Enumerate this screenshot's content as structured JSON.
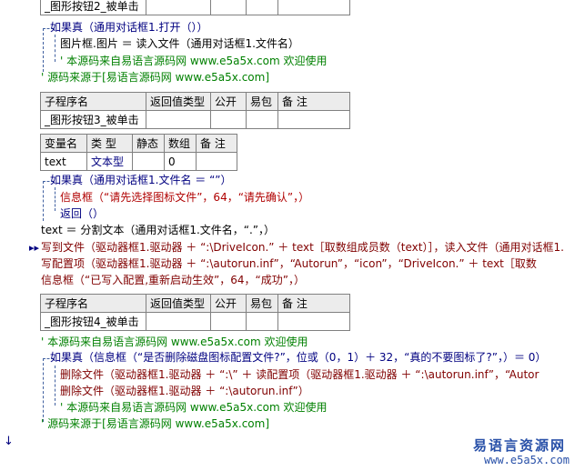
{
  "sub1": {
    "name": "_图形按钮2_被单击"
  },
  "block1": {
    "if_line": "如果真（通用对话框1.打开（））",
    "assign_line": "图片框.图片 ＝ 读入文件（通用对话框1.文件名）",
    "comment1": "' 本源码来自易语言源码网 www.e5a5x.com  欢迎使用",
    "comment2": "' 源码来源于[易语言源码网 www.e5a5x.com]"
  },
  "table_headers": {
    "c1": "子程序名",
    "c2": "返回值类型",
    "c3": "公开",
    "c4": "易包",
    "c5": "备 注"
  },
  "sub2": {
    "name": "_图形按钮3_被单击"
  },
  "var_headers": {
    "c1": "变量名",
    "c2": "类 型",
    "c3": "静态",
    "c4": "数组",
    "c5": "备 注"
  },
  "var_row": {
    "name": "text",
    "type": "文本型",
    "static": "",
    "array": "0",
    "note": ""
  },
  "block2": {
    "if_line": "如果真（通用对话框1.文件名 ＝ “”）",
    "msg_line": "信息框（“请先选择图标文件”，64，“请先确认”，）",
    "return_line": "返回（）",
    "split_line": "text ＝ 分割文本（通用对话框1.文件名，“.”，）",
    "write_line": "写到文件（驱动器框1.驱动器 ＋ “:\\DriveIcon.” ＋ text［取数组成员数（text）］，读入文件（通用对话框1.",
    "cfg_line": "写配置项（驱动器框1.驱动器 ＋ “:\\autorun.inf”，“Autorun”，“icon”，“DriveIcon.” ＋ text［取数",
    "msg2_line": "信息框（“已写入配置,重新启动生效”，64，“成功”，）"
  },
  "sub3": {
    "name": "_图形按钮4_被单击"
  },
  "block3": {
    "comment1": "' 本源码来自易语言源码网 www.e5a5x.com  欢迎使用",
    "if_line": "如果真（信息框（“是否删除磁盘图标配置文件?”，位或（0，1）＋ 32，“真的不要图标了?”，）＝ 0）",
    "del1_line": "删除文件（驱动器框1.驱动器 ＋ “:\\” ＋ 读配置项（驱动器框1.驱动器 ＋ “:\\autorun.inf”，“Autor",
    "del2_line": "删除文件（驱动器框1.驱动器 ＋ “:\\autorun.inf”）",
    "comment2": "' 本源码来自易语言源码网 www.e5a5x.com  欢迎使用",
    "comment3": "' 源码来源于[易语言源码网 www.e5a5x.com]"
  },
  "watermark": {
    "title": "易语言资源网",
    "url": "www.e5a5x.com"
  }
}
